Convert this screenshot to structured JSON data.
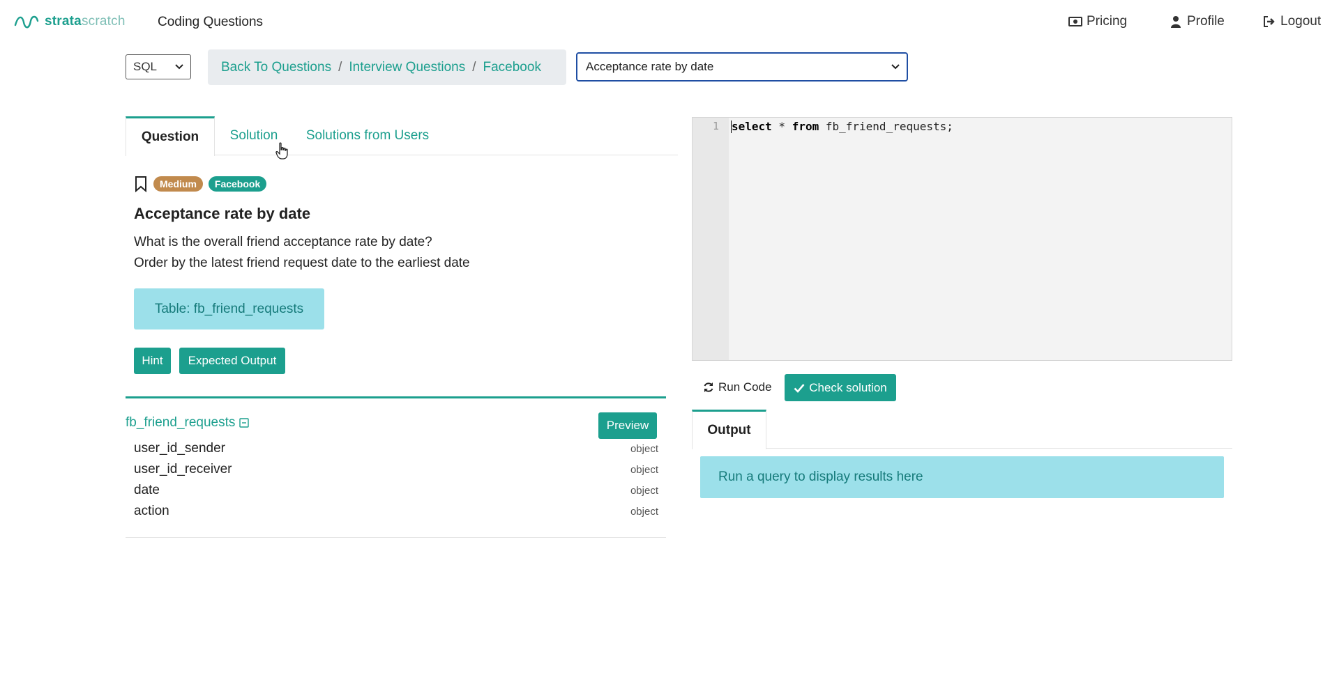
{
  "brand": {
    "name_bold": "strata",
    "name_light": "scratch"
  },
  "nav": {
    "title": "Coding Questions",
    "pricing": "Pricing",
    "profile": "Profile",
    "logout": "Logout"
  },
  "toolbar": {
    "language": "SQL",
    "breadcrumb": [
      "Back To Questions",
      "Interview Questions",
      "Facebook"
    ],
    "breadcrumb_separator": "/",
    "question_selected": "Acceptance rate by date"
  },
  "tabs": {
    "question": "Question",
    "solution": "Solution",
    "solutions_from_users": "Solutions from Users"
  },
  "question": {
    "difficulty": "Medium",
    "company": "Facebook",
    "title": "Acceptance rate by date",
    "description": [
      "What is the overall friend acceptance rate by date?",
      "Order by the latest friend request date to the earliest date"
    ],
    "table_label": "Table: fb_friend_requests",
    "hint_label": "Hint",
    "expected_output_label": "Expected Output"
  },
  "schema": {
    "table_name": "fb_friend_requests",
    "preview_label": "Preview",
    "columns": [
      {
        "name": "user_id_sender",
        "type": "object"
      },
      {
        "name": "user_id_receiver",
        "type": "object"
      },
      {
        "name": "date",
        "type": "object"
      },
      {
        "name": "action",
        "type": "object"
      }
    ]
  },
  "editor": {
    "line_number": "1",
    "kw_select": "select",
    "star": " * ",
    "kw_from": "from",
    "rest": " fb_friend_requests;"
  },
  "actions": {
    "run_code": "Run Code",
    "check_solution": "Check solution"
  },
  "output": {
    "tab": "Output",
    "placeholder": "Run a query to display results here"
  },
  "colors": {
    "accent": "#1c9f8e",
    "info_bg": "#9ce0ea",
    "difficulty_medium": "#c18a4d",
    "select_border": "#1f4ea3"
  }
}
